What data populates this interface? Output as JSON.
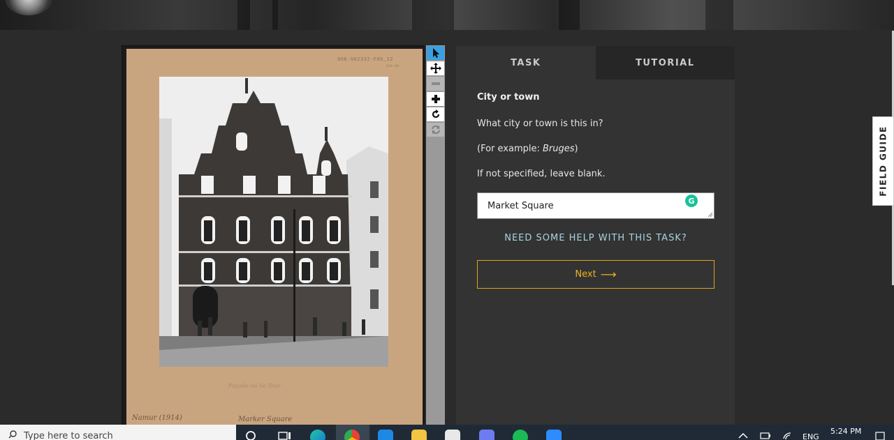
{
  "viewer": {
    "mount_code": "00K-902332-F06_12",
    "mount_subcode": "826-00",
    "caption_mid": "Façade ou 5e Tour",
    "caption_left": "Namur (1914)",
    "caption_right": "Marker Square"
  },
  "tools": [
    {
      "icon": "pointer-icon",
      "state": "active"
    },
    {
      "icon": "move-icon",
      "state": "normal"
    },
    {
      "icon": "zoom-out-icon",
      "state": "disabled"
    },
    {
      "icon": "zoom-in-icon",
      "state": "normal"
    },
    {
      "icon": "rotate-icon",
      "state": "normal"
    },
    {
      "icon": "reset-icon",
      "state": "disabled"
    }
  ],
  "panel": {
    "tabs": [
      {
        "label": "TASK",
        "active": true
      },
      {
        "label": "TUTORIAL",
        "active": false
      }
    ],
    "question_title": "City or town",
    "question_line1": "What city or town is this in?",
    "example_prefix": "(For example: ",
    "example_value": "Bruges",
    "example_suffix": ")",
    "instruction": "If not specified, leave blank.",
    "answer_value": "Market Square",
    "help_link": "NEED SOME HELP WITH THIS TASK?",
    "next_label": "Next",
    "next_arrow": "⟶"
  },
  "field_guide": {
    "label": "FIELD GUIDE"
  },
  "taskbar": {
    "search_placeholder": "Type here to search",
    "lang": "ENG",
    "time": "5:24 PM"
  },
  "colors": {
    "accent": "#f0b323",
    "help_link": "#a8d4e0",
    "active_tool": "#3aa0e0",
    "panel_bg": "#333333",
    "page_bg": "#2b2b2b"
  }
}
